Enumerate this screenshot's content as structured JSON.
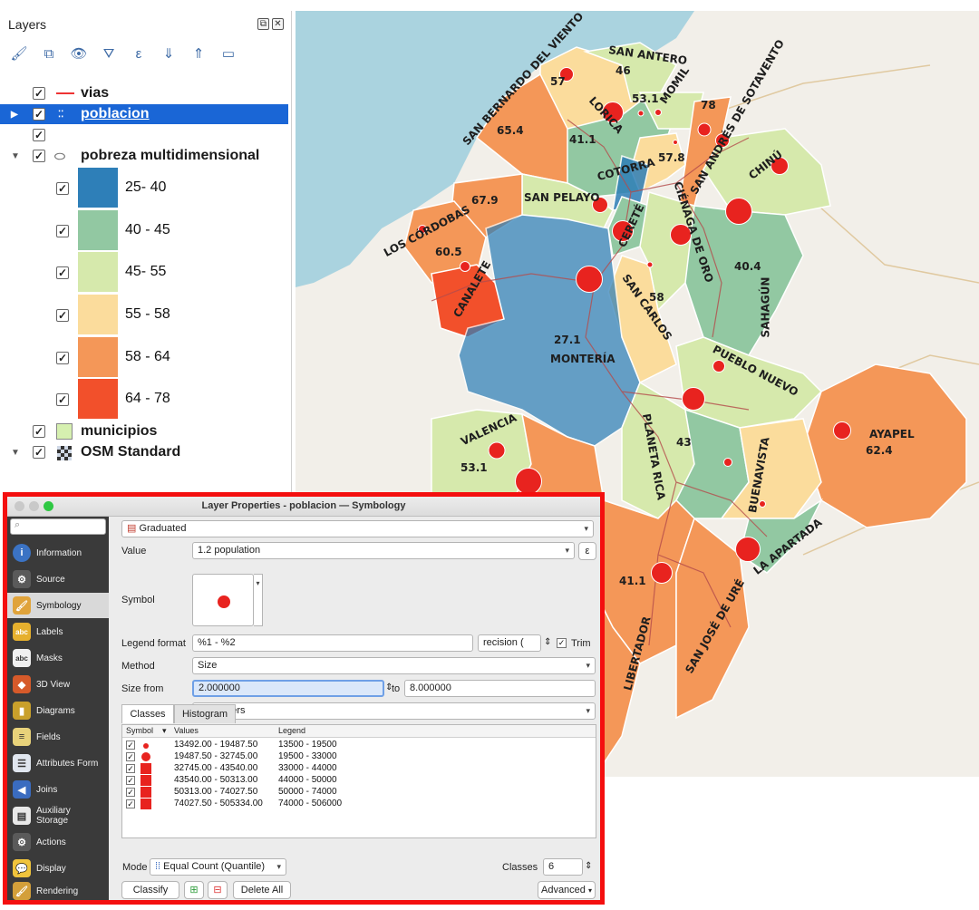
{
  "layers_panel": {
    "title": "Layers",
    "layers": [
      {
        "name": "vias",
        "checked": true
      },
      {
        "name": "poblacion",
        "checked": true,
        "selected": true
      },
      {
        "name": "",
        "checked": true
      },
      {
        "name": "pobreza multidimensional",
        "checked": true
      },
      {
        "name": "municipios",
        "checked": true
      },
      {
        "name": "OSM Standard",
        "checked": true
      }
    ],
    "poverty_classes": [
      {
        "label": "25- 40",
        "color": "#2e7fb8"
      },
      {
        "label": "40 - 45",
        "color": "#92c8a2"
      },
      {
        "label": "45- 55",
        "color": "#d6e9ac"
      },
      {
        "label": "55 - 58",
        "color": "#fbdc9c"
      },
      {
        "label": "58 - 64",
        "color": "#f49758"
      },
      {
        "label": "64 - 78",
        "color": "#f2502b"
      }
    ]
  },
  "map": {
    "municipality_labels": [
      "SAN ANTERO",
      "SAN BERNARDO DEL VIENTO",
      "MOMIL",
      "LORICA",
      "SAN ANDRÉS DE SOTAVENTO",
      "CHINÚ",
      "COTORRA",
      "SAN PELAYO",
      "CIÉNAGA DE ORO",
      "CERETÉ",
      "LOS CÓRDOBAS",
      "CANALETE",
      "SAN CARLOS",
      "SAHAGÚN",
      "MONTERÍA",
      "PUEBLO NUEVO",
      "VALENCIA",
      "PLANETA RICA",
      "AYAPEL",
      "BUENAVISTA",
      "LA APARTADA",
      "SAN JOSÉ DE URÉ",
      "LIBERTADOR"
    ],
    "values": [
      "57",
      "46",
      "53.1",
      "78",
      "65.4",
      "41.1",
      "57.8",
      "67.9",
      "60.5",
      "40.4",
      "58",
      "27.1",
      "43",
      "62.4",
      "53.1",
      "41.1"
    ]
  },
  "dialog": {
    "title": "Layer Properties - poblacion — Symbology",
    "sidebar_items": [
      "Information",
      "Source",
      "Symbology",
      "Labels",
      "Masks",
      "3D View",
      "Diagrams",
      "Fields",
      "Attributes Form",
      "Joins",
      "Auxiliary Storage",
      "Actions",
      "Display",
      "Rendering"
    ],
    "renderer": "Graduated",
    "value_label": "Value",
    "value_field": "1.2  population",
    "symbol_label": "Symbol",
    "legend_format_label": "Legend format",
    "legend_format": "%1 - %2",
    "precision": "recision (",
    "trim_label": "Trim",
    "method_label": "Method",
    "method": "Size",
    "size_from_label": "Size from",
    "size_from": "2.000000",
    "to_label": "to",
    "size_to": "8.000000",
    "unit": "Millimeters",
    "tabs": [
      "Classes",
      "Histogram"
    ],
    "table_headers": [
      "Symbol",
      "Values",
      "Legend"
    ],
    "classes": [
      {
        "values": "13492.00 - 19487.50",
        "legend": "13500 - 19500"
      },
      {
        "values": "19487.50 - 32745.00",
        "legend": "19500 - 33000"
      },
      {
        "values": "32745.00 - 43540.00",
        "legend": "33000 - 44000"
      },
      {
        "values": "43540.00 - 50313.00",
        "legend": "44000 - 50000"
      },
      {
        "values": "50313.00 - 74027.50",
        "legend": "50000 - 74000"
      },
      {
        "values": "74027.50 - 505334.00",
        "legend": "74000 - 506000"
      }
    ],
    "mode_label": "Mode",
    "mode": "Equal Count (Quantile)",
    "classes_label": "Classes",
    "classes_count": "6",
    "classify_button": "Classify",
    "delete_all_button": "Delete All",
    "advanced_button": "Advanced"
  }
}
